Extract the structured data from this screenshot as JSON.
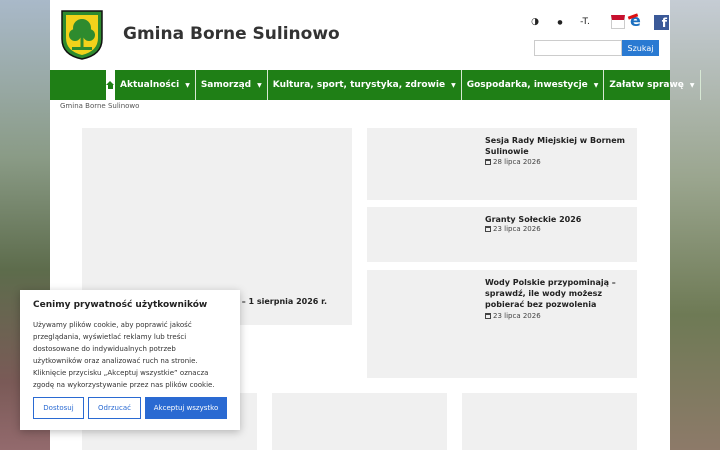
{
  "header": {
    "site_title": "Gmina Borne Sulinowo",
    "tools": [
      {
        "name": "contrast-icon",
        "glyph": "◑"
      },
      {
        "name": "drop-icon",
        "glyph": "●"
      },
      {
        "name": "font-size-icon",
        "glyph": "-T."
      }
    ],
    "search": {
      "placeholder": "",
      "button_label": "Szukaj"
    },
    "fb_label": "f",
    "e_label": "e"
  },
  "nav": {
    "items": [
      {
        "label": "Aktualności"
      },
      {
        "label": "Samorząd"
      },
      {
        "label": "Kultura, sport, turystyka, zdrowie"
      },
      {
        "label": "Gospodarka, inwestycje"
      },
      {
        "label": "Załatw sprawę"
      }
    ]
  },
  "breadcrumb": "Gmina Borne Sulinowo",
  "feature": {
    "title_fragment": "ych – 1 sierpnia 2026 r."
  },
  "news": [
    {
      "title": "Sesja Rady Miejskiej w Bornem Sulinowie",
      "date": "28 lipca 2026"
    },
    {
      "title": "Granty Sołeckie 2026",
      "date": "23 lipca 2026"
    },
    {
      "title": "Wody Polskie przypominają – sprawdź, ile wody możesz pobierać bez pozwolenia",
      "date": "23 lipca 2026"
    }
  ],
  "cookie": {
    "title": "Cenimy prywatność użytkowników",
    "text": "Używamy plików cookie, aby poprawić jakość przeglądania, wyświetlać reklamy lub treści dostosowane do indywidualnych potrzeb użytkowników oraz analizować ruch na stronie. Kliknięcie przycisku „Akceptuj wszystkie” oznacza zgodę na wykorzystywanie przez nas plików cookie.",
    "buttons": {
      "customize": "Dostosuj",
      "reject": "Odrzucać",
      "accept": "Akceptuj wszystko"
    }
  },
  "colors": {
    "nav_green": "#1f7f16",
    "accent_blue": "#2a6ad2"
  }
}
